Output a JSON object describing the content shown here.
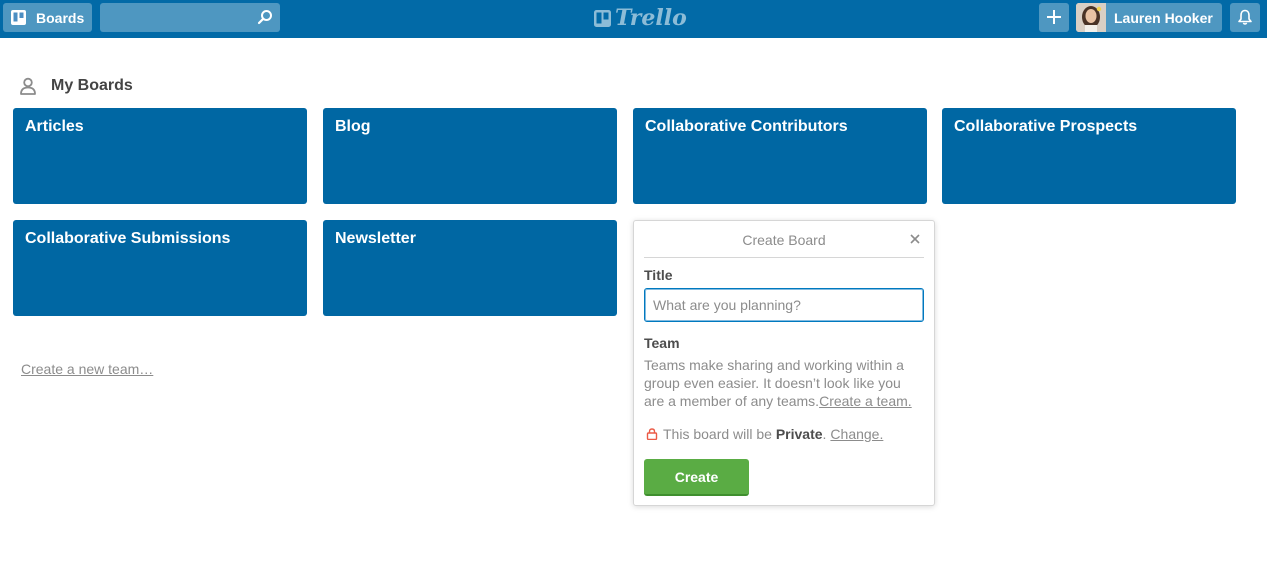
{
  "header": {
    "boards_label": "Boards",
    "search_placeholder": "",
    "logo_text": "Trello",
    "member_name": "Lauren Hooker"
  },
  "section": {
    "title": "My Boards"
  },
  "boards": [
    {
      "title": "Articles"
    },
    {
      "title": "Blog"
    },
    {
      "title": "Collaborative Contributors"
    },
    {
      "title": "Collaborative Prospects"
    },
    {
      "title": "Collaborative Submissions"
    },
    {
      "title": "Newsletter"
    }
  ],
  "create_team_link": "Create a new team…",
  "popover": {
    "title": "Create Board",
    "title_label": "Title",
    "title_placeholder": "What are you planning?",
    "team_label": "Team",
    "team_desc": "Teams make sharing and working within a group even easier. It doesn’t look like you are a member of any teams.",
    "team_link": "Create a team.",
    "privacy_prefix": "This board will be",
    "privacy_value": "Private",
    "privacy_suffix": ".",
    "privacy_change": "Change.",
    "create_button": "Create"
  },
  "colors": {
    "header": "#026aa7",
    "board_tile": "#0067a3",
    "create_button": "#5aac44",
    "lock_icon": "#eb5a46"
  },
  "icons": {
    "boards": "boards-icon",
    "search": "search-icon",
    "add": "plus-icon",
    "notifications": "bell-icon",
    "member": "person-icon",
    "close": "close-icon",
    "lock": "lock-icon"
  }
}
